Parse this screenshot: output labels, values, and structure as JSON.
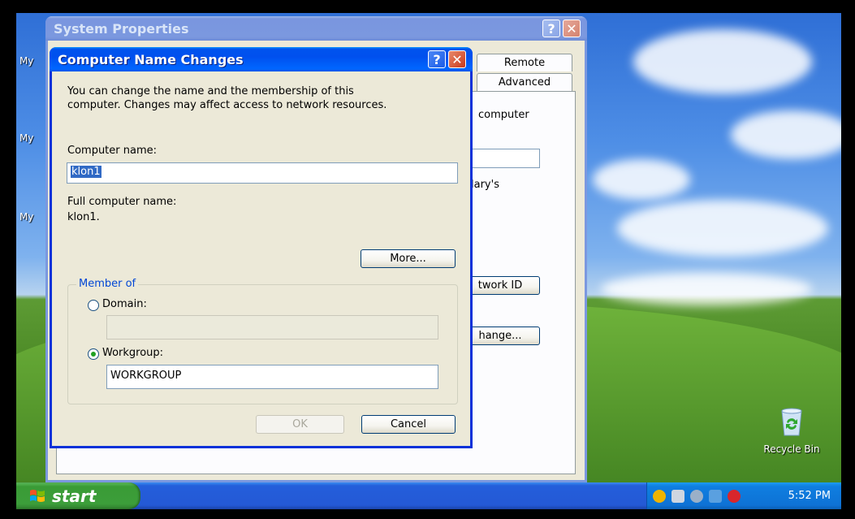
{
  "desktop": {
    "icons": [
      "My",
      "My",
      "My"
    ],
    "recycle_bin": "Recycle Bin"
  },
  "taskbar": {
    "start_label": "start",
    "clock": "5:52 PM",
    "tray_icons": [
      "shield-alert-icon",
      "vmware-icon",
      "volume-icon",
      "network-icon",
      "security-alert-icon"
    ]
  },
  "system_properties": {
    "title": "System Properties",
    "tabs": [
      "Remote",
      "Advanced"
    ],
    "fragments": {
      "computer": "computer",
      "marys": "lary's",
      "network_id_button": "twork ID",
      "change_button": "hange..."
    }
  },
  "computer_name_changes": {
    "title": "Computer Name Changes",
    "description_line1": "You can change the name and the membership of this",
    "description_line2": "computer. Changes may affect access to network resources.",
    "computer_name_label": "Computer name:",
    "computer_name_value": "klon1",
    "full_name_label": "Full computer name:",
    "full_name_value": "klon1.",
    "more_button": "More...",
    "member_of": {
      "title": "Member of",
      "domain_label": "Domain:",
      "domain_value": "",
      "workgroup_label": "Workgroup:",
      "workgroup_value": "WORKGROUP",
      "selected": "Workgroup"
    },
    "ok_button": "OK",
    "cancel_button": "Cancel"
  }
}
